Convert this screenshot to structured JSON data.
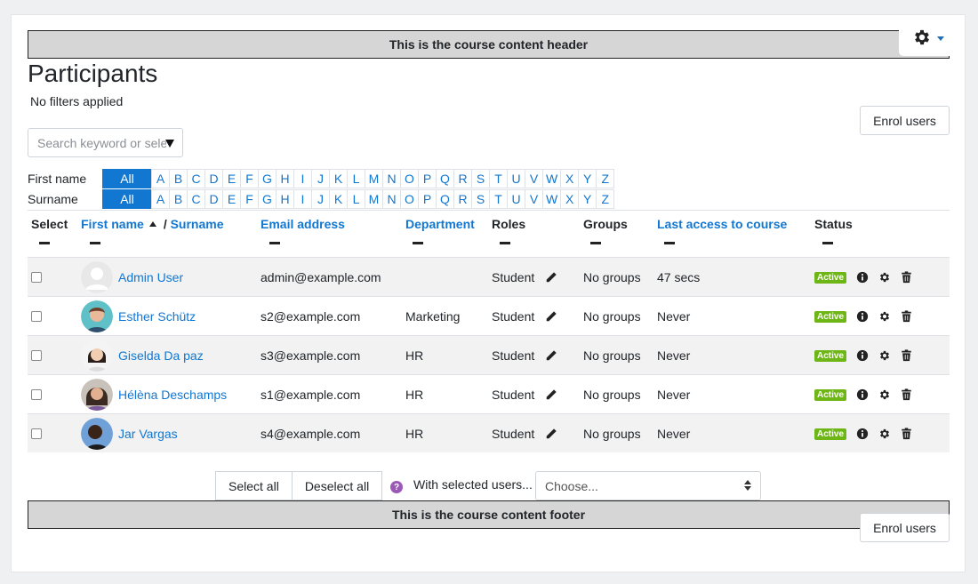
{
  "header_bar": "This is the course content header",
  "footer_bar": "This is the course content footer",
  "page_title": "Participants",
  "filters_text": "No filters applied",
  "enrol_label": "Enrol users",
  "search": {
    "placeholder": "Search keyword or select filter"
  },
  "initials": {
    "first_label": "First name",
    "surname_label": "Surname",
    "all_label": "All",
    "letters": [
      "A",
      "B",
      "C",
      "D",
      "E",
      "F",
      "G",
      "H",
      "I",
      "J",
      "K",
      "L",
      "M",
      "N",
      "O",
      "P",
      "Q",
      "R",
      "S",
      "T",
      "U",
      "V",
      "W",
      "X",
      "Y",
      "Z"
    ]
  },
  "columns": {
    "select": "Select",
    "firstname": "First name",
    "separator": "/",
    "surname": "Surname",
    "email": "Email address",
    "department": "Department",
    "roles": "Roles",
    "groups": "Groups",
    "lastaccess": "Last access to course",
    "status": "Status"
  },
  "rows": [
    {
      "name": "Admin User",
      "email": "admin@example.com",
      "department": "",
      "role": "Student",
      "groups": "No groups",
      "lastaccess": "47 secs",
      "status": "Active",
      "avatar": "default"
    },
    {
      "name": "Esther Schütz",
      "email": "s2@example.com",
      "department": "Marketing",
      "role": "Student",
      "groups": "No groups",
      "lastaccess": "Never",
      "status": "Active",
      "avatar": "teal"
    },
    {
      "name": "Giselda Da paz",
      "email": "s3@example.com",
      "department": "HR",
      "role": "Student",
      "groups": "No groups",
      "lastaccess": "Never",
      "status": "Active",
      "avatar": "light"
    },
    {
      "name": "Hélèna Deschamps",
      "email": "s1@example.com",
      "department": "HR",
      "role": "Student",
      "groups": "No groups",
      "lastaccess": "Never",
      "status": "Active",
      "avatar": "brown"
    },
    {
      "name": "Jar Vargas",
      "email": "s4@example.com",
      "department": "HR",
      "role": "Student",
      "groups": "No groups",
      "lastaccess": "Never",
      "status": "Active",
      "avatar": "dark"
    }
  ],
  "bulk": {
    "select_all": "Select all",
    "deselect_all": "Deselect all",
    "with_selected": "With selected users...",
    "choose": "Choose..."
  },
  "colors": {
    "link": "#1177d1",
    "active_badge": "#6db615",
    "help": "#9b59b6"
  },
  "icons": {
    "settings": "gear-icon",
    "info": "info-icon",
    "edit": "pencil-icon",
    "delete": "trash-icon",
    "help": "question-icon"
  }
}
